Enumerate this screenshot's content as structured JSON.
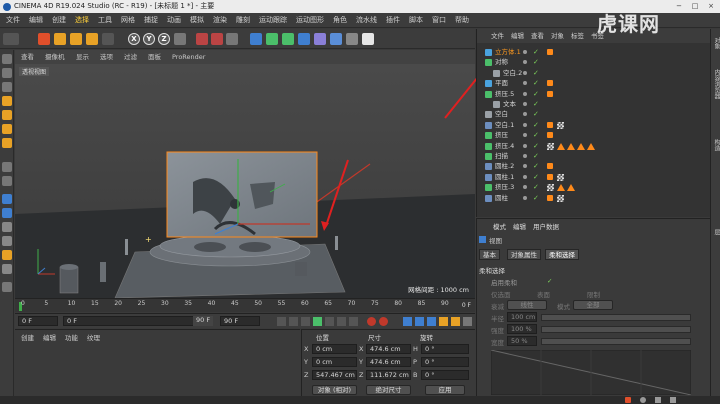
{
  "window": {
    "title": "CINEMA 4D R19.024 Studio (RC - R19) - [未标题 1 *] - 主要",
    "controls": [
      "−",
      "□",
      "×"
    ]
  },
  "watermark": "虎课网",
  "menubar": [
    "文件",
    "编辑",
    "创建",
    "选择",
    "工具",
    "网格",
    "捕捉",
    "动画",
    "模拟",
    "渲染",
    "雕刻",
    "运动跟踪",
    "运动图形",
    "角色",
    "流水线",
    "插件",
    "脚本",
    "窗口",
    "帮助"
  ],
  "menubar_highlight": "选择",
  "toolbar": {
    "axis_buttons": [
      "X",
      "Y",
      "Z"
    ]
  },
  "viewport": {
    "menu": [
      "查看",
      "摄像机",
      "显示",
      "选项",
      "过滤",
      "面板",
      "ProRender"
    ],
    "label": "透视视图",
    "grid_readout": "网格间距 : 1000 cm"
  },
  "timeline": {
    "ticks": [
      "0",
      "5",
      "10",
      "15",
      "20",
      "25",
      "30",
      "35",
      "40",
      "45",
      "50",
      "55",
      "60",
      "65",
      "70",
      "75",
      "80",
      "85",
      "90"
    ],
    "end_marker": "0 F",
    "start_field": "0 F",
    "current_field": "0 F",
    "end_field": "90 F",
    "max_field": "90 F"
  },
  "material_panel": {
    "menu": [
      "创建",
      "编辑",
      "功能",
      "纹理"
    ]
  },
  "coords": {
    "headers": [
      "位置",
      "尺寸",
      "旋转"
    ],
    "rows": [
      {
        "axis": "X",
        "pos": "0 cm",
        "size": "474.6 cm",
        "rot_label": "H",
        "rot": "0 °"
      },
      {
        "axis": "Y",
        "pos": "0 cm",
        "size": "474.6 cm",
        "rot_label": "P",
        "rot": "0 °"
      },
      {
        "axis": "Z",
        "pos": "547.467 cm",
        "size": "111.672 cm",
        "rot_label": "B",
        "rot": "0 °"
      }
    ],
    "dropdown_left": "对象 (相对)",
    "dropdown_mid": "绝对尺寸",
    "apply_button": "应用"
  },
  "object_manager": {
    "menu": [
      "文件",
      "编辑",
      "查看",
      "对象",
      "标签",
      "书签"
    ],
    "rows": [
      {
        "name": "立方体.1",
        "indent": 0,
        "selected": true,
        "icon": "#4aa3df",
        "tags": [
          "dot"
        ]
      },
      {
        "name": "对称",
        "indent": 0,
        "selected": false,
        "icon": "#4bbf6a",
        "tags": []
      },
      {
        "name": "空白.2",
        "indent": 8,
        "selected": false,
        "icon": "#9aa0a6",
        "tags": []
      },
      {
        "name": "平面",
        "indent": 0,
        "selected": false,
        "icon": "#4aa3df",
        "tags": [
          "dot"
        ]
      },
      {
        "name": "挤压.5",
        "indent": 0,
        "selected": false,
        "icon": "#4bbf6a",
        "tags": [
          "dot"
        ]
      },
      {
        "name": "文本",
        "indent": 8,
        "selected": false,
        "icon": "#9aa0a6",
        "tags": []
      },
      {
        "name": "空白",
        "indent": 0,
        "selected": false,
        "icon": "#9aa0a6",
        "tags": []
      },
      {
        "name": "空白.1",
        "indent": 0,
        "selected": false,
        "icon": "#6c8ebf",
        "tags": [
          "dot",
          "chk"
        ]
      },
      {
        "name": "挤压",
        "indent": 0,
        "selected": false,
        "icon": "#4bbf6a",
        "tags": [
          "dot"
        ]
      },
      {
        "name": "挤压.4",
        "indent": 0,
        "selected": false,
        "icon": "#4bbf6a",
        "tags": [
          "chk",
          "tri",
          "tri",
          "tri",
          "tri"
        ]
      },
      {
        "name": "扫描",
        "indent": 0,
        "selected": false,
        "icon": "#4bbf6a",
        "tags": []
      },
      {
        "name": "圆柱.2",
        "indent": 0,
        "selected": false,
        "icon": "#6c8ebf",
        "tags": [
          "dot"
        ]
      },
      {
        "name": "圆柱.1",
        "indent": 0,
        "selected": false,
        "icon": "#6c8ebf",
        "tags": [
          "dot",
          "chk"
        ]
      },
      {
        "name": "挤压.3",
        "indent": 0,
        "selected": false,
        "icon": "#4bbf6a",
        "tags": [
          "chk",
          "tri",
          "tri"
        ]
      },
      {
        "name": "圆柱",
        "indent": 0,
        "selected": false,
        "icon": "#6c8ebf",
        "tags": [
          "dot",
          "chk"
        ]
      }
    ]
  },
  "attributes": {
    "menu": [
      "模式",
      "编辑",
      "用户数据"
    ],
    "title": "视图",
    "tabs": [
      "基本",
      "对象属性",
      "柔和选择"
    ],
    "active_tab": "柔和选择",
    "section": "柔和选择",
    "rows": [
      {
        "label": "启用柔和",
        "value": "✓"
      },
      {
        "label": "仅选面",
        "value": ""
      },
      {
        "label": "表面",
        "value": ""
      },
      {
        "label": "限制",
        "value": ""
      }
    ],
    "mode_label": "衰减",
    "mode_value": "线性",
    "mode2_label": "模式",
    "mode2_value": "全部",
    "radius_label": "半径",
    "radius_value": "100 cm",
    "strength_label": "强度",
    "strength_value": "100 %",
    "width_label": "宽度",
    "width_value": "50 %"
  },
  "right_strip": [
    "对象",
    "内容浏览器",
    "构造",
    "层"
  ]
}
